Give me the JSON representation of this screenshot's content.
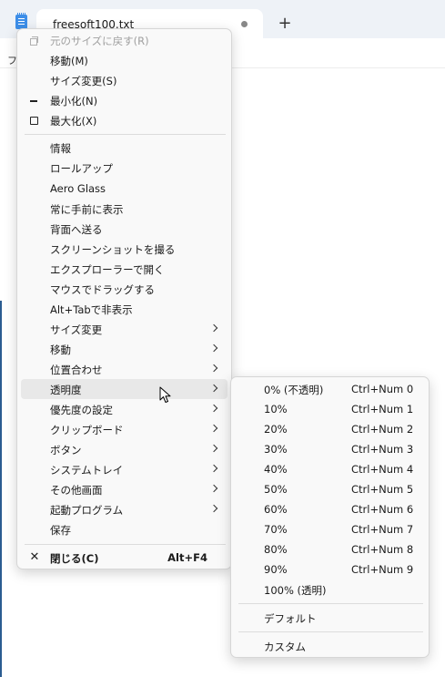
{
  "window": {
    "tab_title": "freesoft100.txt",
    "new_tab_label": "+",
    "fragment_text": "フ"
  },
  "menu": {
    "items": [
      {
        "label": "元のサイズに戻す(R)",
        "icon": "restore-icon",
        "disabled": true
      },
      {
        "label": "移動(M)"
      },
      {
        "label": "サイズ変更(S)"
      },
      {
        "label": "最小化(N)",
        "icon": "minimize-icon"
      },
      {
        "label": "最大化(X)",
        "icon": "maximize-icon"
      },
      {
        "label": "情報"
      },
      {
        "label": "ロールアップ"
      },
      {
        "label": "Aero Glass"
      },
      {
        "label": "常に手前に表示"
      },
      {
        "label": "背面へ送る"
      },
      {
        "label": "スクリーンショットを撮る"
      },
      {
        "label": "エクスプローラーで開く"
      },
      {
        "label": "マウスでドラッグする"
      },
      {
        "label": "Alt+Tabで非表示"
      },
      {
        "label": "サイズ変更",
        "submenu": true
      },
      {
        "label": "移動",
        "submenu": true
      },
      {
        "label": "位置合わせ",
        "submenu": true
      },
      {
        "label": "透明度",
        "submenu": true,
        "highlighted": true
      },
      {
        "label": "優先度の設定",
        "submenu": true
      },
      {
        "label": "クリップボード",
        "submenu": true
      },
      {
        "label": "ボタン",
        "submenu": true
      },
      {
        "label": "システムトレイ",
        "submenu": true
      },
      {
        "label": "その他画面",
        "submenu": true
      },
      {
        "label": "起動プログラム",
        "submenu": true
      },
      {
        "label": "保存"
      },
      {
        "label": "閉じる(C)",
        "icon": "close-icon",
        "shortcut": "Alt+F4"
      }
    ]
  },
  "submenu": {
    "items": [
      {
        "label": "0% (不透明)",
        "shortcut": "Ctrl+Num 0"
      },
      {
        "label": "10%",
        "shortcut": "Ctrl+Num 1"
      },
      {
        "label": "20%",
        "shortcut": "Ctrl+Num 2"
      },
      {
        "label": "30%",
        "shortcut": "Ctrl+Num 3"
      },
      {
        "label": "40%",
        "shortcut": "Ctrl+Num 4"
      },
      {
        "label": "50%",
        "shortcut": "Ctrl+Num 5"
      },
      {
        "label": "60%",
        "shortcut": "Ctrl+Num 6"
      },
      {
        "label": "70%",
        "shortcut": "Ctrl+Num 7"
      },
      {
        "label": "80%",
        "shortcut": "Ctrl+Num 8"
      },
      {
        "label": "90%",
        "shortcut": "Ctrl+Num 9"
      },
      {
        "label": "100% (透明)"
      },
      {
        "label": "デフォルト"
      },
      {
        "label": "カスタム"
      }
    ]
  },
  "colors": {
    "accent_tab_icon": "#3d8ee8",
    "highlight": "#e8e8e8",
    "menu_bg": "#f9f9f9"
  }
}
